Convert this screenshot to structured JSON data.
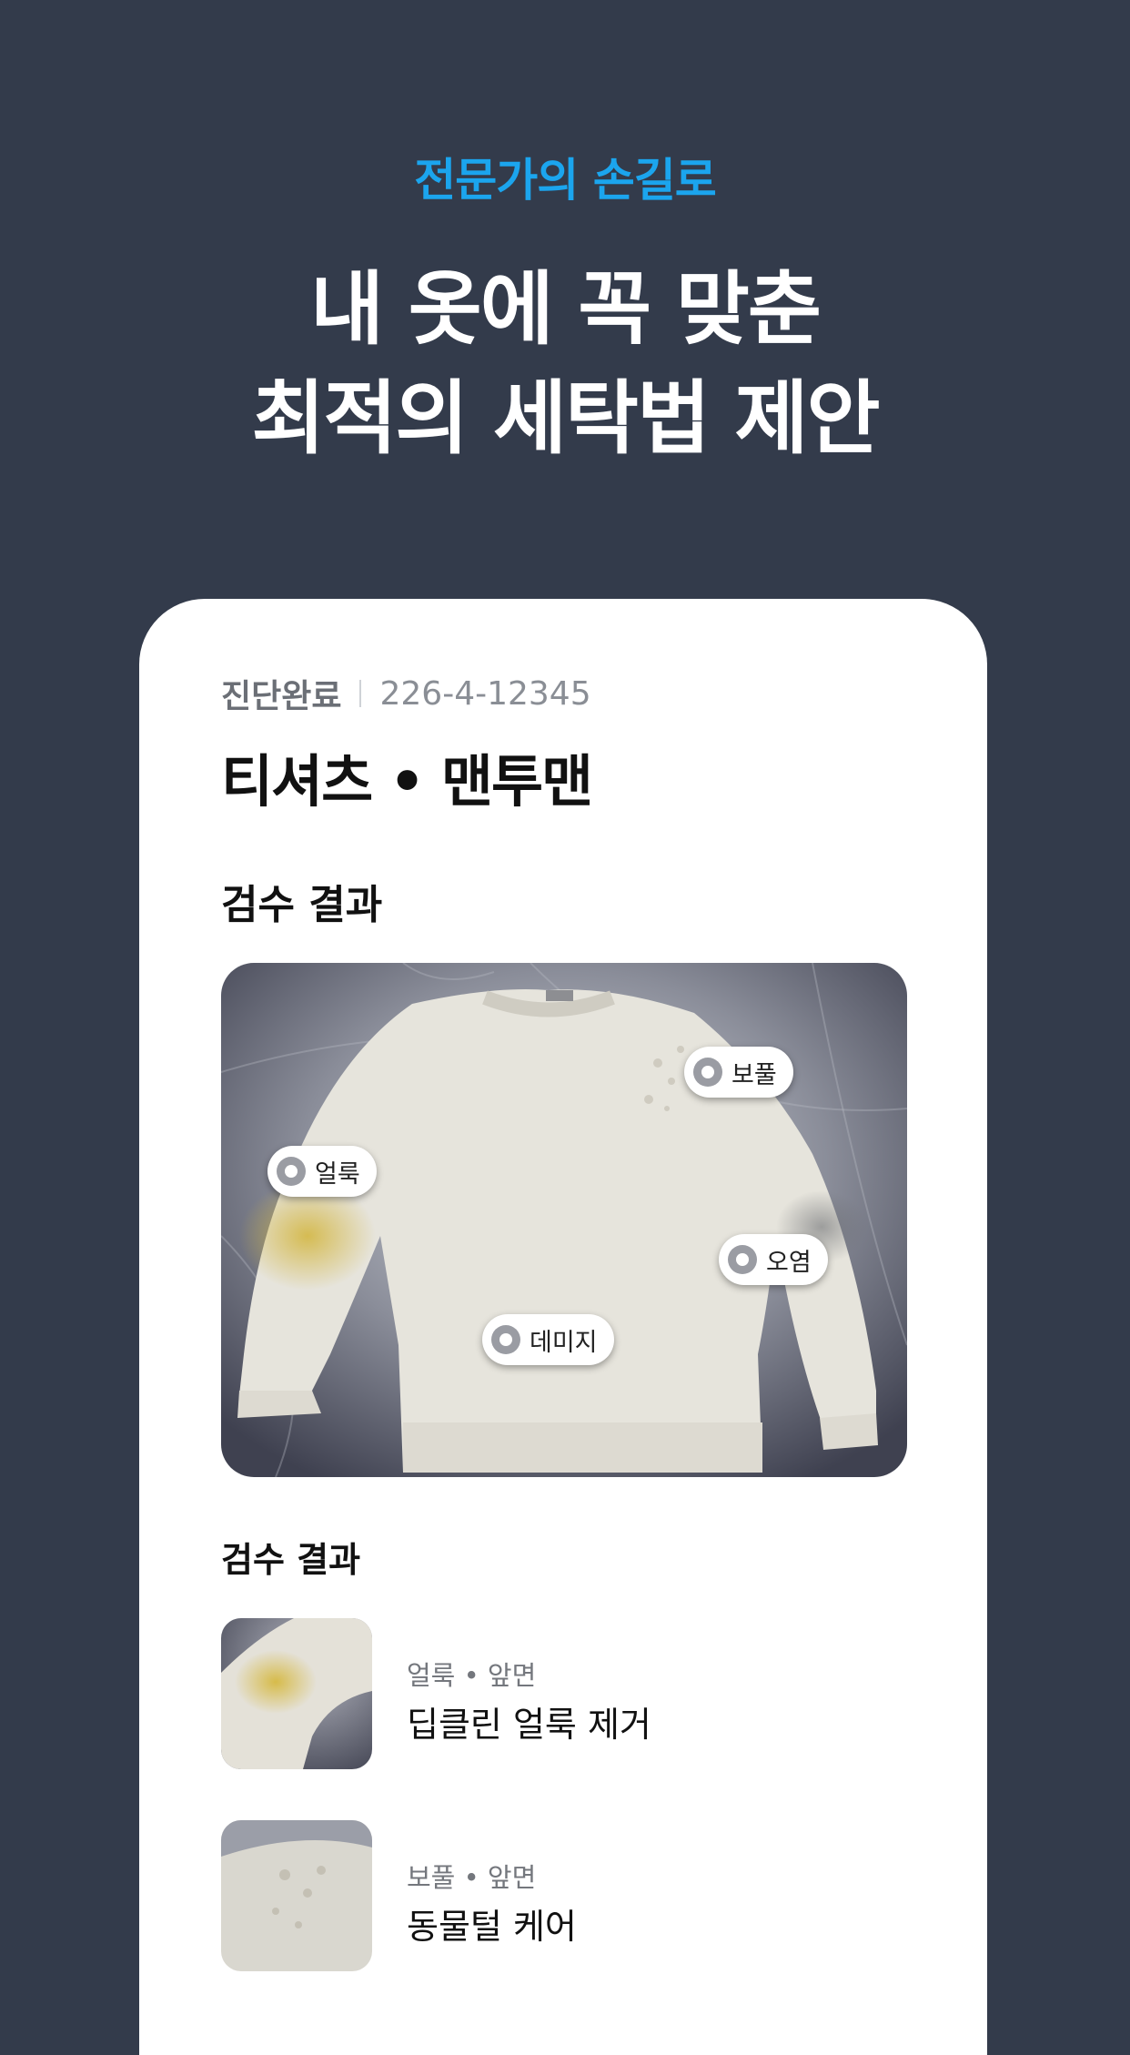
{
  "hero": {
    "subtitle": "전문가의 손길로",
    "title_line1": "내 옷에 꼭 맞춘",
    "title_line2": "최적의 세탁법 제안"
  },
  "card": {
    "status": "진단완료",
    "code": "226-4-12345",
    "product_title": "티셔츠 • 맨투맨",
    "section_title": "검수 결과",
    "photo": {
      "tags": [
        "보풀",
        "얼룩",
        "오염",
        "데미지"
      ]
    },
    "results_title": "검수 결과",
    "results": [
      {
        "sub": "얼룩 • 앞면",
        "main": "딥클린 얼룩 제거",
        "thumb_icon": "stain-thumbnail"
      },
      {
        "sub": "보풀 • 앞면",
        "main": "동물털 케어",
        "thumb_icon": "pilling-thumbnail"
      }
    ]
  },
  "colors": {
    "background": "#333b4b",
    "accent": "#1ba5ee",
    "card": "#ffffff"
  }
}
